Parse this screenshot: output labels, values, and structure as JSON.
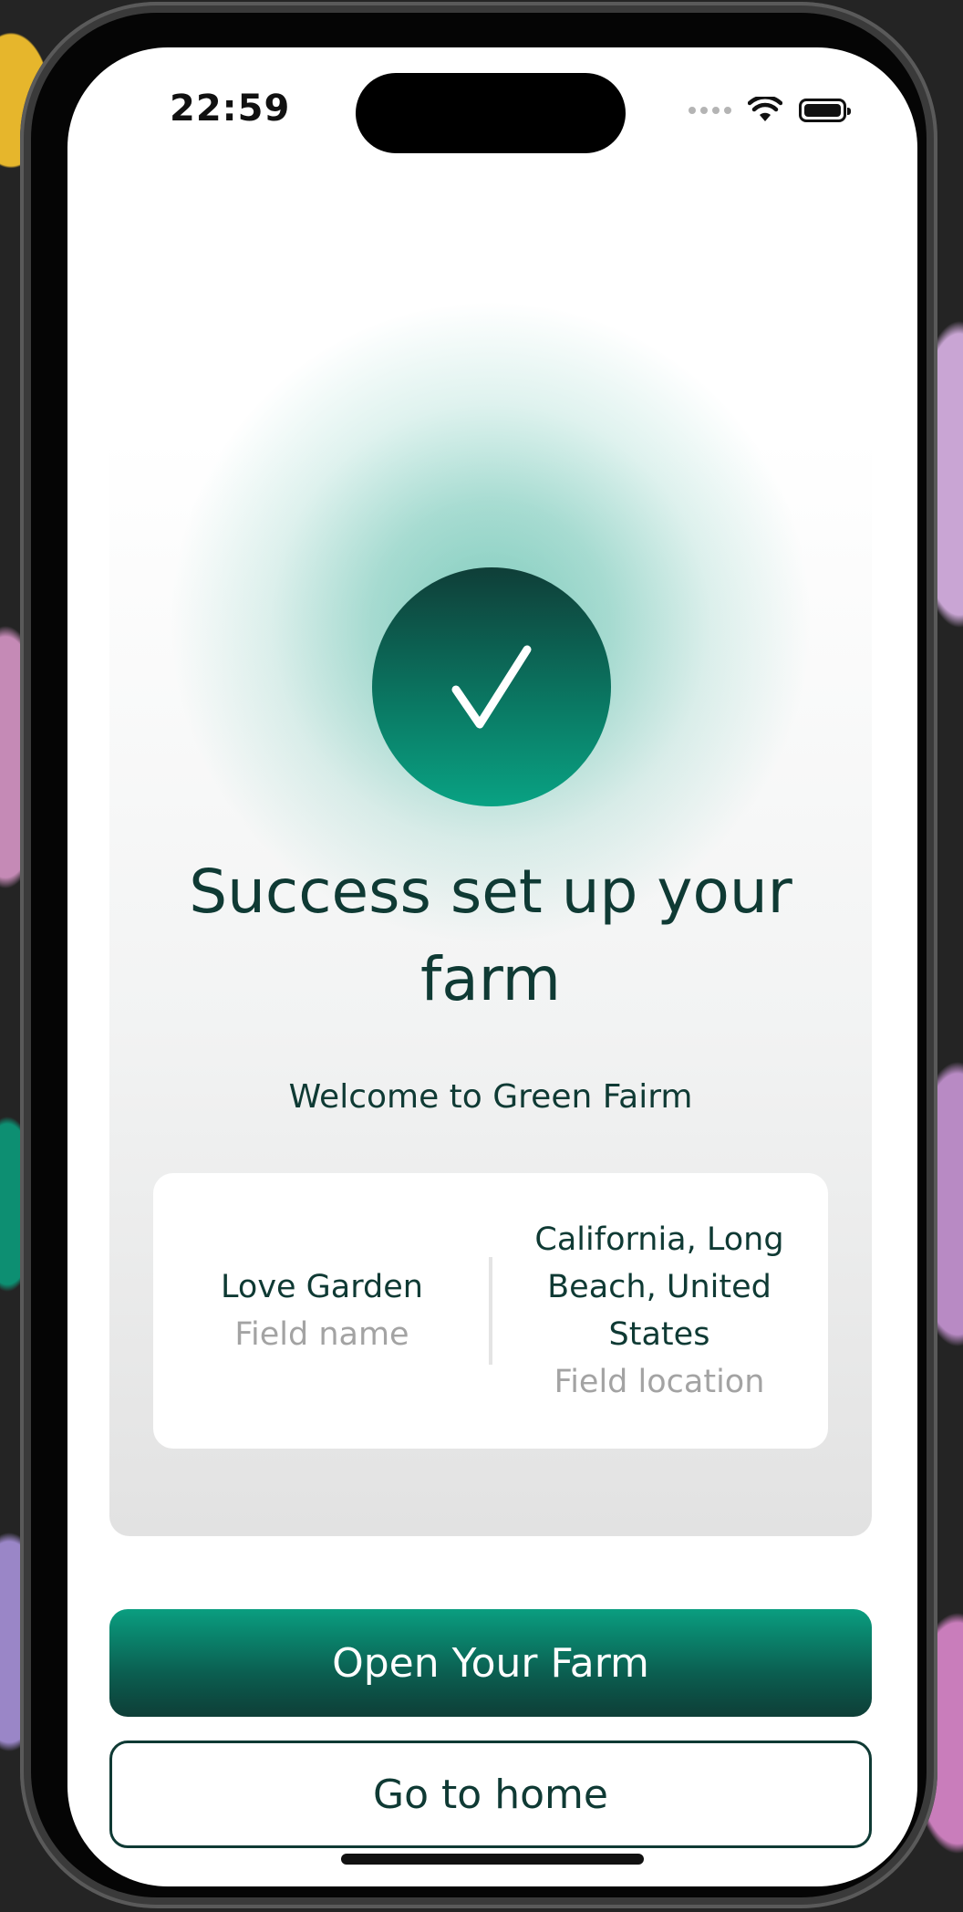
{
  "status_bar": {
    "time": "22:59",
    "icons": [
      "cellular-signal-icon",
      "wifi-icon",
      "battery-icon"
    ]
  },
  "success": {
    "icon": "checkmark-icon",
    "title": "Success set up your farm",
    "subtitle": "Welcome to Green Fairm"
  },
  "field_info": {
    "name_value": "Love Garden",
    "name_label": "Field name",
    "location_value": "California, Long Beach, United States",
    "location_label": "Field location"
  },
  "actions": {
    "primary_label": "Open Your Farm",
    "secondary_label": "Go to home"
  },
  "colors": {
    "brand_dark": "#0f3a34",
    "brand_accent": "#09a283"
  }
}
